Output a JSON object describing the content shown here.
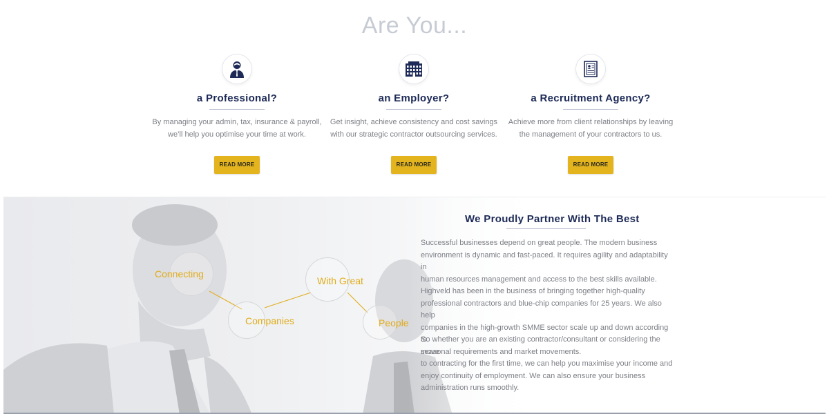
{
  "heading": "Are You...",
  "cards": [
    {
      "icon": "person-icon",
      "title": "a Professional?",
      "description_lines": [
        "By managing your admin, tax, insurance & payroll,",
        "we’ll help you optimise your time at work."
      ],
      "button": "READ MORE"
    },
    {
      "icon": "building-icon",
      "title": "an Employer?",
      "description_lines": [
        "Get insight, achieve consistency and cost savings",
        "with our strategic contractor outsourcing services."
      ],
      "button": "READ MORE"
    },
    {
      "icon": "document-icon",
      "title": "a Recruitment Agency?",
      "description_lines": [
        "Achieve more from client relationships by leaving",
        "the management of your contractors to us."
      ],
      "button": "READ MORE"
    }
  ],
  "bubbles": [
    "Connecting",
    "Companies",
    "With Great",
    "People"
  ],
  "partner": {
    "title": "We Proudly Partner With The Best",
    "paragraph1_lines": [
      "Successful businesses depend on great people. The modern business",
      "environment is dynamic and fast-paced. It requires agility and adaptability in",
      "human resources management and access to the best skills available.",
      "Highveld has been in the business of bringing together high-quality",
      "professional contractors and blue-chip companies for 25 years. We also help",
      "companies in the high-growth SMME sector scale up and down according to",
      "seasonal requirements and market movements."
    ],
    "paragraph2_lines": [
      "So whether you are an existing contractor/consultant or considering the move",
      "to contracting for the first time, we can help you maximise your income and",
      "enjoy continuity of employment. We can also ensure your business",
      "administration runs smoothly."
    ]
  },
  "colors": {
    "navy": "#1d2a57",
    "gold": "#e3b41e",
    "bubble_text": "#e0ac19",
    "body_text": "#7d7f86",
    "heading_grey": "#c6cbd4"
  }
}
